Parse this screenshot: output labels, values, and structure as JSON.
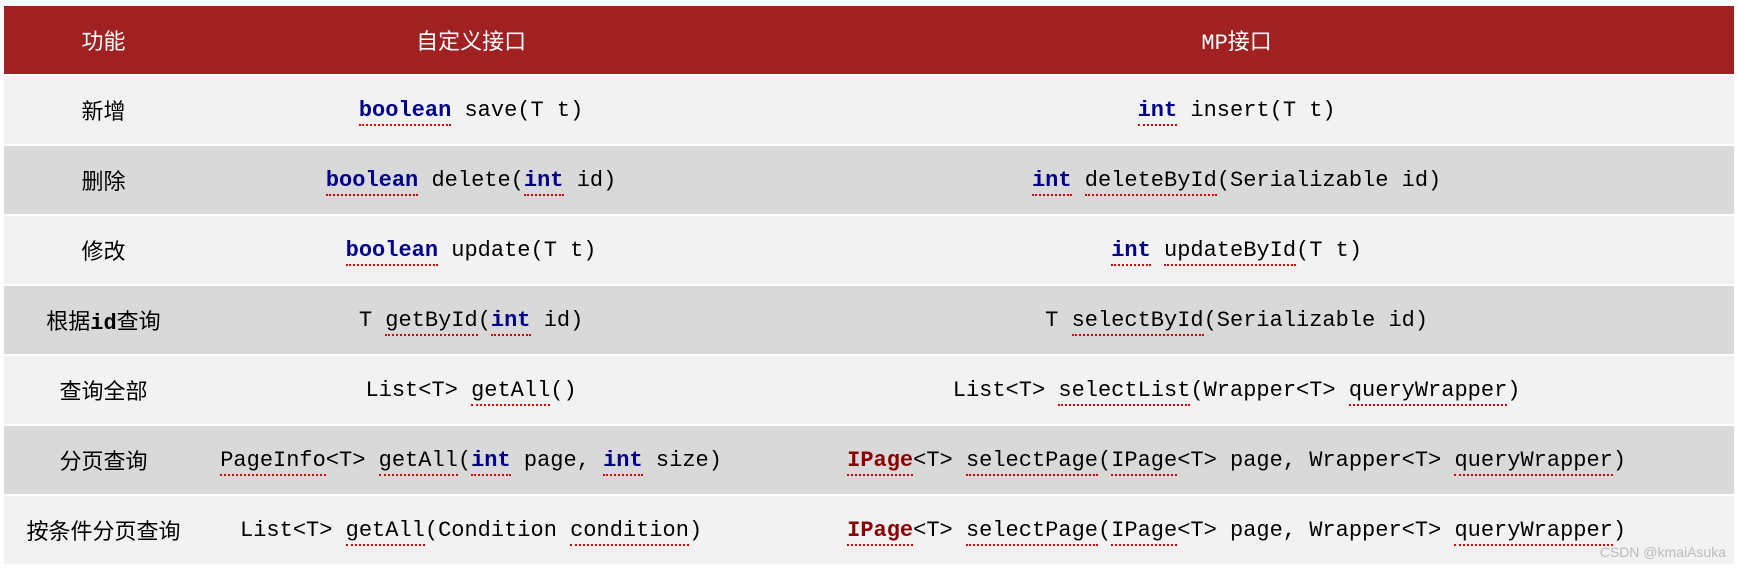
{
  "headers": {
    "c1": "功能",
    "c2": "自定义接口",
    "c3": "MP接口"
  },
  "rows": [
    {
      "feature": "新增",
      "custom": [
        {
          "t": "boolean",
          "cls": "kw ul"
        },
        {
          "t": " save(T t)",
          "cls": "code"
        }
      ],
      "mp": [
        {
          "t": "int",
          "cls": "kw ul"
        },
        {
          "t": " insert(T t)",
          "cls": "code"
        }
      ]
    },
    {
      "feature": "删除",
      "custom": [
        {
          "t": "boolean",
          "cls": "kw ul"
        },
        {
          "t": " delete(",
          "cls": "code"
        },
        {
          "t": "int",
          "cls": "kw ul"
        },
        {
          "t": " id)",
          "cls": "code"
        }
      ],
      "mp": [
        {
          "t": "int",
          "cls": "kw ul"
        },
        {
          "t": " ",
          "cls": "code"
        },
        {
          "t": "deleteById",
          "cls": "code ul"
        },
        {
          "t": "(Serializable id)",
          "cls": "code"
        }
      ]
    },
    {
      "feature": "修改",
      "custom": [
        {
          "t": "boolean",
          "cls": "kw ul"
        },
        {
          "t": " update(T t)",
          "cls": "code"
        }
      ],
      "mp": [
        {
          "t": "int",
          "cls": "kw ul"
        },
        {
          "t": " ",
          "cls": "code"
        },
        {
          "t": "updateById",
          "cls": "code ul"
        },
        {
          "t": "(T t)",
          "cls": "code"
        }
      ]
    },
    {
      "feature_parts": [
        {
          "t": "根据",
          "cls": ""
        },
        {
          "t": "id",
          "cls": "bold"
        },
        {
          "t": "查询",
          "cls": ""
        }
      ],
      "custom": [
        {
          "t": "T ",
          "cls": "code"
        },
        {
          "t": "getById",
          "cls": "code ul"
        },
        {
          "t": "(",
          "cls": "code"
        },
        {
          "t": "int",
          "cls": "kw ul"
        },
        {
          "t": " id)",
          "cls": "code"
        }
      ],
      "mp": [
        {
          "t": "T ",
          "cls": "code"
        },
        {
          "t": "selectById",
          "cls": "code ul"
        },
        {
          "t": "(Serializable id)",
          "cls": "code"
        }
      ]
    },
    {
      "feature": "查询全部",
      "custom": [
        {
          "t": "List<T> ",
          "cls": "code"
        },
        {
          "t": "getAll",
          "cls": "code ul"
        },
        {
          "t": "()",
          "cls": "code"
        }
      ],
      "mp": [
        {
          "t": "List<T> ",
          "cls": "code"
        },
        {
          "t": "selectList",
          "cls": "code ul"
        },
        {
          "t": "(Wrapper<T> ",
          "cls": "code"
        },
        {
          "t": "queryWrapper",
          "cls": "code ul"
        },
        {
          "t": ")",
          "cls": "code"
        }
      ]
    },
    {
      "feature": "分页查询",
      "custom": [
        {
          "t": "PageInfo",
          "cls": "code ul"
        },
        {
          "t": "<T> ",
          "cls": "code"
        },
        {
          "t": "getAll",
          "cls": "code ul"
        },
        {
          "t": "(",
          "cls": "code"
        },
        {
          "t": "int",
          "cls": "kw ul"
        },
        {
          "t": " page, ",
          "cls": "code"
        },
        {
          "t": "int",
          "cls": "kw ul"
        },
        {
          "t": " size)",
          "cls": "code"
        }
      ],
      "mp": [
        {
          "t": "IPage",
          "cls": "cls ul"
        },
        {
          "t": "<T> ",
          "cls": "code"
        },
        {
          "t": "selectPage",
          "cls": "code ul"
        },
        {
          "t": "(",
          "cls": "code"
        },
        {
          "t": "IPage",
          "cls": "code ul"
        },
        {
          "t": "<T> page, Wrapper<T> ",
          "cls": "code"
        },
        {
          "t": "queryWrapper",
          "cls": "code ul"
        },
        {
          "t": ")",
          "cls": "code"
        }
      ]
    },
    {
      "feature": "按条件分页查询",
      "custom": [
        {
          "t": "List<T> ",
          "cls": "code"
        },
        {
          "t": "getAll",
          "cls": "code ul"
        },
        {
          "t": "(Condition ",
          "cls": "code"
        },
        {
          "t": "condition",
          "cls": "code ul"
        },
        {
          "t": ")",
          "cls": "code"
        }
      ],
      "mp": [
        {
          "t": "IPage",
          "cls": "cls ul"
        },
        {
          "t": "<T> ",
          "cls": "code"
        },
        {
          "t": "selectPage",
          "cls": "code ul"
        },
        {
          "t": "(",
          "cls": "code"
        },
        {
          "t": "IPage",
          "cls": "code ul"
        },
        {
          "t": "<T> page, Wrapper<T> ",
          "cls": "code"
        },
        {
          "t": "queryWrapper",
          "cls": "code ul"
        },
        {
          "t": ")",
          "cls": "code"
        }
      ]
    }
  ],
  "watermark": "CSDN @kmaiAsuka"
}
